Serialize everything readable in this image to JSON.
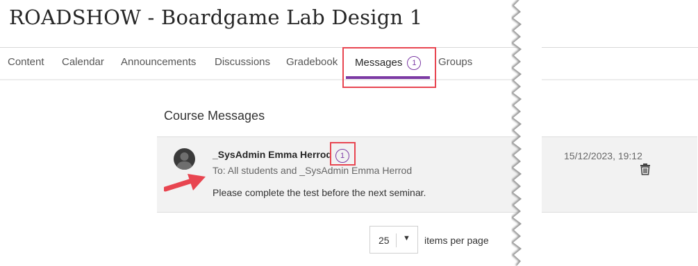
{
  "course": {
    "title": "ROADSHOW - Boardgame Lab Design 1"
  },
  "nav": {
    "tabs": [
      {
        "label": "Content"
      },
      {
        "label": "Calendar"
      },
      {
        "label": "Announcements"
      },
      {
        "label": "Discussions"
      },
      {
        "label": "Gradebook"
      },
      {
        "label": "Messages",
        "badge": "1",
        "active": true
      },
      {
        "label": "Groups"
      }
    ]
  },
  "messages": {
    "section_title": "Course Messages",
    "items": [
      {
        "sender": "_SysAdmin Emma Herrod",
        "unread_badge": "1",
        "recipients": "To: All students and _SysAdmin Emma Herrod",
        "body": "Please complete the test before the next seminar.",
        "timestamp": "15/12/2023, 19:12",
        "avatar_icon": "user-avatar-icon",
        "delete_icon": "trash-icon"
      }
    ]
  },
  "pagination": {
    "per_page_value": "25",
    "per_page_label": "items per page",
    "dropdown_icon": "caret-down-icon"
  },
  "colors": {
    "accent": "#7c3aa4",
    "highlight": "#e84550",
    "row_background": "#f2f2f2"
  }
}
